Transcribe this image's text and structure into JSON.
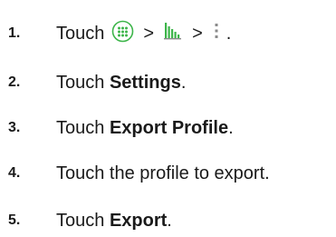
{
  "steps": [
    {
      "number": "1.",
      "parts": {
        "touch": "Touch",
        "sep1": ">",
        "sep2": ">",
        "end": "."
      },
      "icons": [
        "apps-grid-icon",
        "app-launcher-icon",
        "overflow-menu-icon"
      ]
    },
    {
      "number": "2.",
      "prefix": "Touch ",
      "bold": "Settings",
      "suffix": "."
    },
    {
      "number": "3.",
      "prefix": "Touch ",
      "bold": "Export Profile",
      "suffix": "."
    },
    {
      "number": "4.",
      "text": "Touch the profile to export."
    },
    {
      "number": "5.",
      "prefix": "Touch ",
      "bold": "Export",
      "suffix": "."
    }
  ],
  "colors": {
    "text": "#1a1a1a",
    "icon_green": "#3db54a",
    "icon_grey": "#8a8a8a"
  }
}
